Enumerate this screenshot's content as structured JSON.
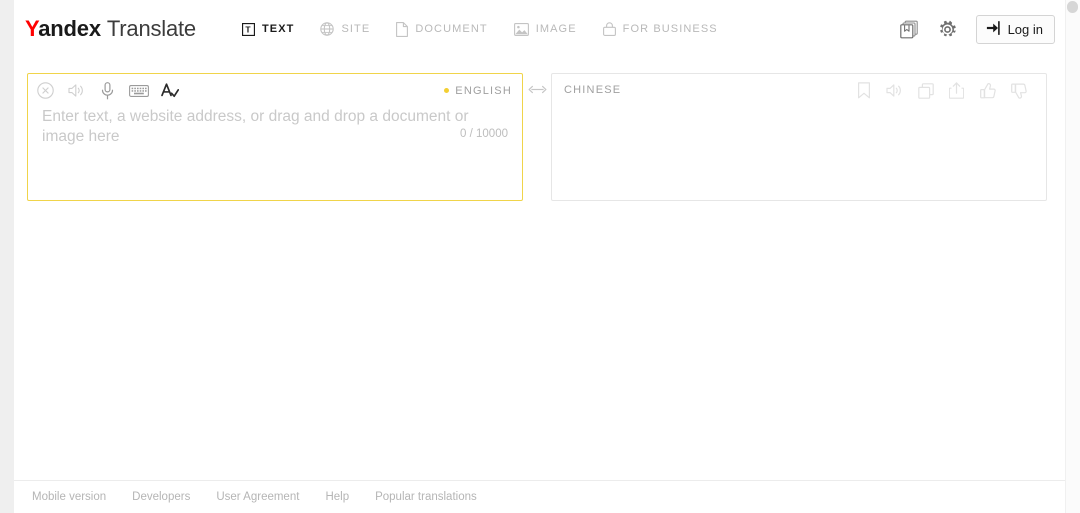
{
  "header": {
    "logo": {
      "brand": "Yandex",
      "brand_initial": "Y",
      "brand_rest": "andex",
      "product": "Translate",
      "brand_color": "#ff0000"
    },
    "tabs": [
      {
        "label": "TEXT",
        "icon": "text-box-icon",
        "active": true
      },
      {
        "label": "SITE",
        "icon": "globe-icon",
        "active": false
      },
      {
        "label": "DOCUMENT",
        "icon": "document-icon",
        "active": false
      },
      {
        "label": "IMAGE",
        "icon": "image-icon",
        "active": false
      },
      {
        "label": "FOR BUSINESS",
        "icon": "briefcase-icon",
        "active": false
      }
    ],
    "actions": [
      {
        "name": "collections-icon",
        "title": "Collections"
      },
      {
        "name": "gear-icon",
        "title": "Settings"
      }
    ],
    "login_label": "Log in"
  },
  "source_panel": {
    "tools": [
      {
        "name": "clear-icon",
        "title": "Clear"
      },
      {
        "name": "speaker-icon",
        "title": "Listen"
      },
      {
        "name": "microphone-icon",
        "title": "Voice input"
      },
      {
        "name": "keyboard-icon",
        "title": "Virtual keyboard"
      },
      {
        "name": "spellcheck-icon",
        "title": "Spellcheck"
      }
    ],
    "language": "ENGLISH",
    "language_dot_color": "#f3cf33",
    "placeholder": "Enter text, a website address, or drag and drop a document or image here",
    "value": "",
    "char_count": "0 / 10000",
    "border_color": "#f0d44a"
  },
  "swap": {
    "label": "swap-languages",
    "glyph": "↔"
  },
  "target_panel": {
    "language": "CHINESE",
    "value": "",
    "tools": [
      {
        "name": "bookmark-icon",
        "title": "Save"
      },
      {
        "name": "speaker-icon",
        "title": "Listen"
      },
      {
        "name": "copy-icon",
        "title": "Copy"
      },
      {
        "name": "share-icon",
        "title": "Share"
      },
      {
        "name": "thumbs-up-icon",
        "title": "Good translation"
      },
      {
        "name": "thumbs-down-icon",
        "title": "Bad translation"
      }
    ],
    "border_color": "#e6e6e6"
  },
  "footer": {
    "links": [
      {
        "label": "Mobile version"
      },
      {
        "label": "Developers"
      },
      {
        "label": "User Agreement"
      },
      {
        "label": "Help"
      },
      {
        "label": "Popular translations"
      }
    ]
  }
}
